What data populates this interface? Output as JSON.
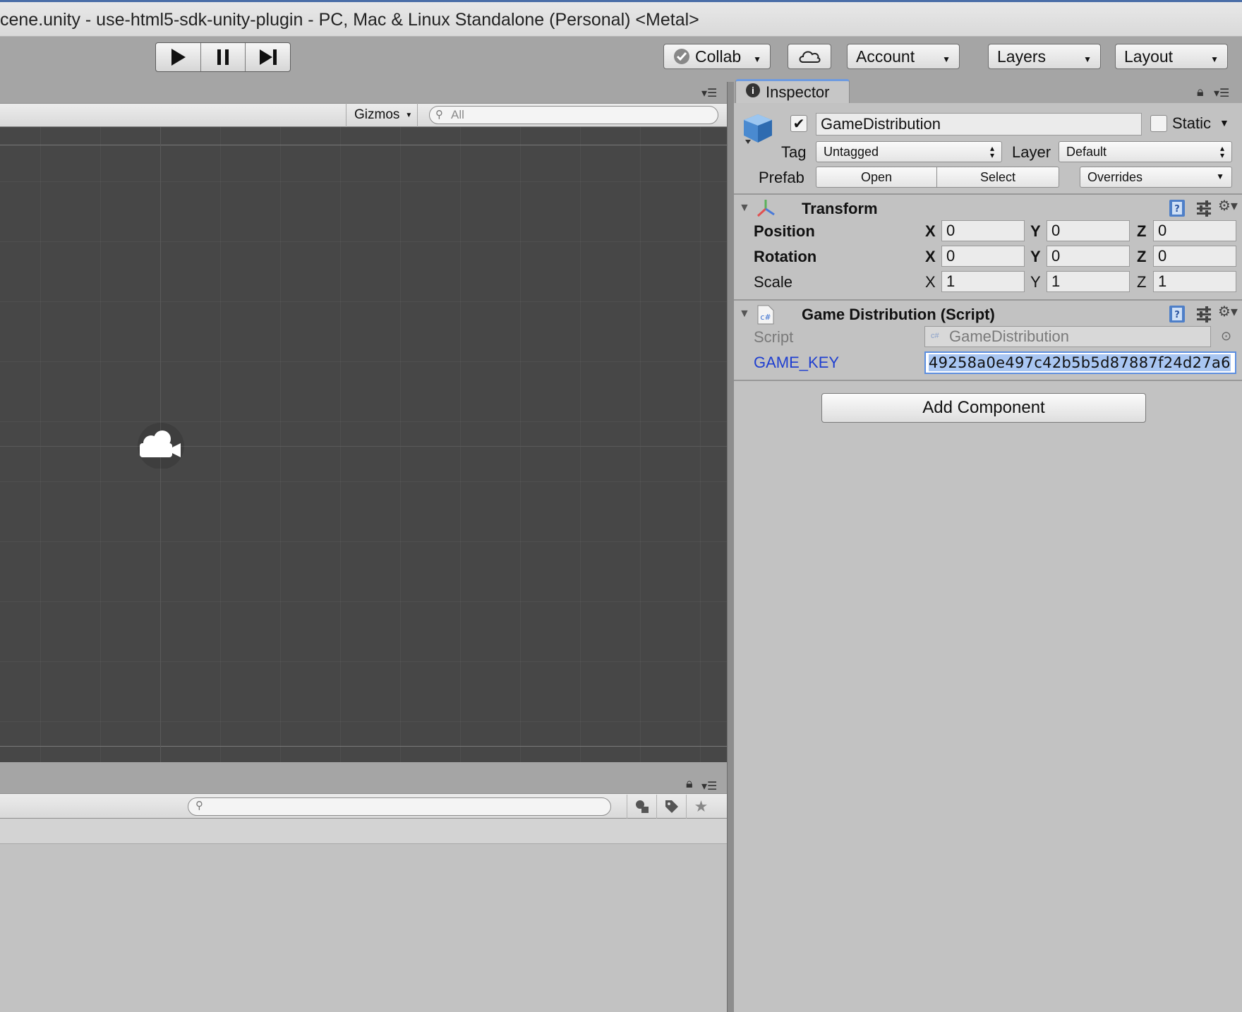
{
  "window": {
    "title": "cene.unity - use-html5-sdk-unity-plugin - PC, Mac & Linux Standalone (Personal) <Metal>"
  },
  "toolbar": {
    "collab_label": "Collab",
    "account_label": "Account",
    "layers_label": "Layers",
    "layout_label": "Layout"
  },
  "scene": {
    "gizmos_label": "Gizmos",
    "search_placeholder": "All"
  },
  "inspector": {
    "tab_label": "Inspector",
    "object_name": "GameDistribution",
    "active": true,
    "static_label": "Static",
    "static_checked": false,
    "tag_label": "Tag",
    "tag_value": "Untagged",
    "layer_label": "Layer",
    "layer_value": "Default",
    "prefab_label": "Prefab",
    "prefab_open": "Open",
    "prefab_select": "Select",
    "prefab_overrides": "Overrides",
    "transform": {
      "title": "Transform",
      "rows": [
        {
          "label": "Position",
          "x": "0",
          "y": "0",
          "z": "0"
        },
        {
          "label": "Rotation",
          "x": "0",
          "y": "0",
          "z": "0"
        },
        {
          "label": "Scale",
          "x": "1",
          "y": "1",
          "z": "1"
        }
      ],
      "axis_x": "X",
      "axis_y": "Y",
      "axis_z": "Z"
    },
    "script_component": {
      "title": "Game Distribution (Script)",
      "script_label": "Script",
      "script_value": "GameDistribution",
      "key_label": "GAME_KEY",
      "key_value": "49258a0e497c42b5b5d87887f24d27a6"
    },
    "add_component_label": "Add Component"
  },
  "colors": {
    "accent_blue": "#6e9be0",
    "selection": "#a9c6f2",
    "scene_bg": "#474747",
    "panel_bg": "#c2c2c2",
    "key_label": "#1f3fd0"
  }
}
